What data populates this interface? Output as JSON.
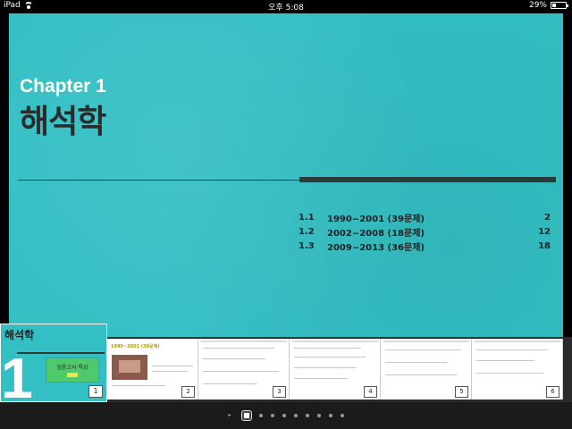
{
  "status_bar": {
    "device": "iPad",
    "time": "오후 5:08",
    "battery_percent": "29%",
    "battery_level": 0.29
  },
  "page": {
    "chapter_label": "Chapter 1",
    "chapter_title": "해석학",
    "toc": [
      {
        "num": "1.1",
        "title": "1990~2001 (39문제)",
        "page": "2"
      },
      {
        "num": "1.2",
        "title": "2002~2008 (18문제)",
        "page": "12"
      },
      {
        "num": "1.3",
        "title": "2009~2013 (36문제)",
        "page": "18"
      }
    ],
    "accent_color": "#33bfc3"
  },
  "thumbnails": {
    "active": {
      "title": "해석학",
      "big_number": "1",
      "card_text": "임용고사 특강",
      "page": "1"
    },
    "items": [
      {
        "page": "2",
        "title": "1990~2001 (39문제)"
      },
      {
        "page": "3"
      },
      {
        "page": "4"
      },
      {
        "page": "5"
      },
      {
        "page": "6"
      }
    ]
  },
  "page_indicator": {
    "count": 9,
    "current": 1
  }
}
